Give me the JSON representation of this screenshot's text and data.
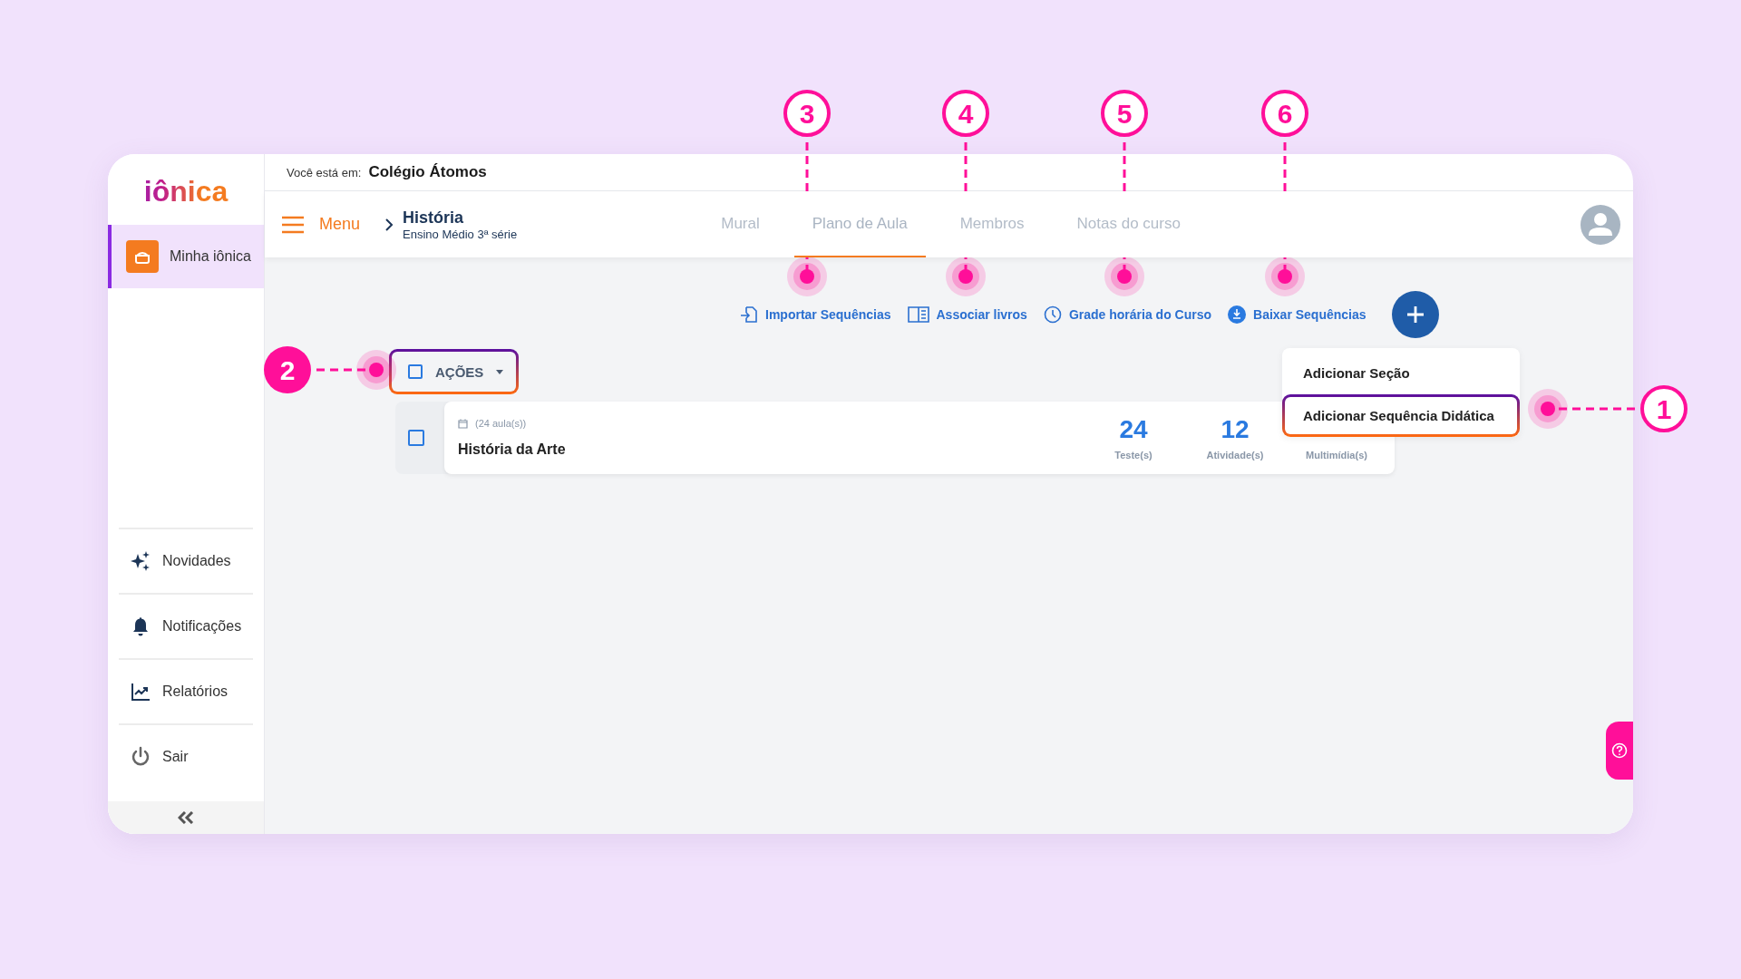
{
  "location_bar": {
    "label": "Você está em:",
    "school": "Colégio Átomos"
  },
  "sidebar": {
    "logo": "iônica",
    "items": [
      {
        "label": "Minha iônica",
        "kind": "home",
        "selected": true
      },
      {
        "label": "Novidades",
        "kind": "news",
        "selected": false
      },
      {
        "label": "Notificações",
        "kind": "bell",
        "selected": false
      },
      {
        "label": "Relatórios",
        "kind": "chart",
        "selected": false
      },
      {
        "label": "Sair",
        "kind": "power",
        "selected": false
      }
    ]
  },
  "header": {
    "menu_label": "Menu",
    "course_title": "História",
    "course_subtitle": "Ensino Médio 3ª série",
    "tabs": [
      {
        "label": "Mural",
        "selected": false
      },
      {
        "label": "Plano de Aula",
        "selected": true
      },
      {
        "label": "Membros",
        "selected": false
      },
      {
        "label": "Notas do curso",
        "selected": false
      }
    ]
  },
  "toolbar": {
    "actions": [
      {
        "label": "Importar Sequências",
        "kind": "import"
      },
      {
        "label": "Associar livros",
        "kind": "book"
      },
      {
        "label": "Grade horária do Curso",
        "kind": "clock"
      },
      {
        "label": "Baixar Sequências",
        "kind": "download"
      }
    ]
  },
  "bulk_actions": {
    "label": "AÇÕES",
    "checked": false
  },
  "sequences": [
    {
      "lessons": "(24 aula(s))",
      "title": "História da Arte",
      "checked": false,
      "stats": [
        {
          "value": "24",
          "label": "Teste(s)"
        },
        {
          "value": "12",
          "label": "Atividade(s)"
        },
        {
          "label": "Multimídia(s)"
        }
      ]
    }
  ],
  "add_menu": {
    "items": [
      {
        "label": "Adicionar Seção",
        "highlighted": false
      },
      {
        "label": "Adicionar Sequência Didática",
        "highlighted": true
      }
    ]
  },
  "callouts": [
    {
      "number": "3",
      "kind": "outlined"
    },
    {
      "number": "4",
      "kind": "outlined"
    },
    {
      "number": "5",
      "kind": "outlined"
    },
    {
      "number": "6",
      "kind": "outlined"
    },
    {
      "number": "2",
      "kind": "filled"
    },
    {
      "number": "1",
      "kind": "outlined"
    }
  ]
}
